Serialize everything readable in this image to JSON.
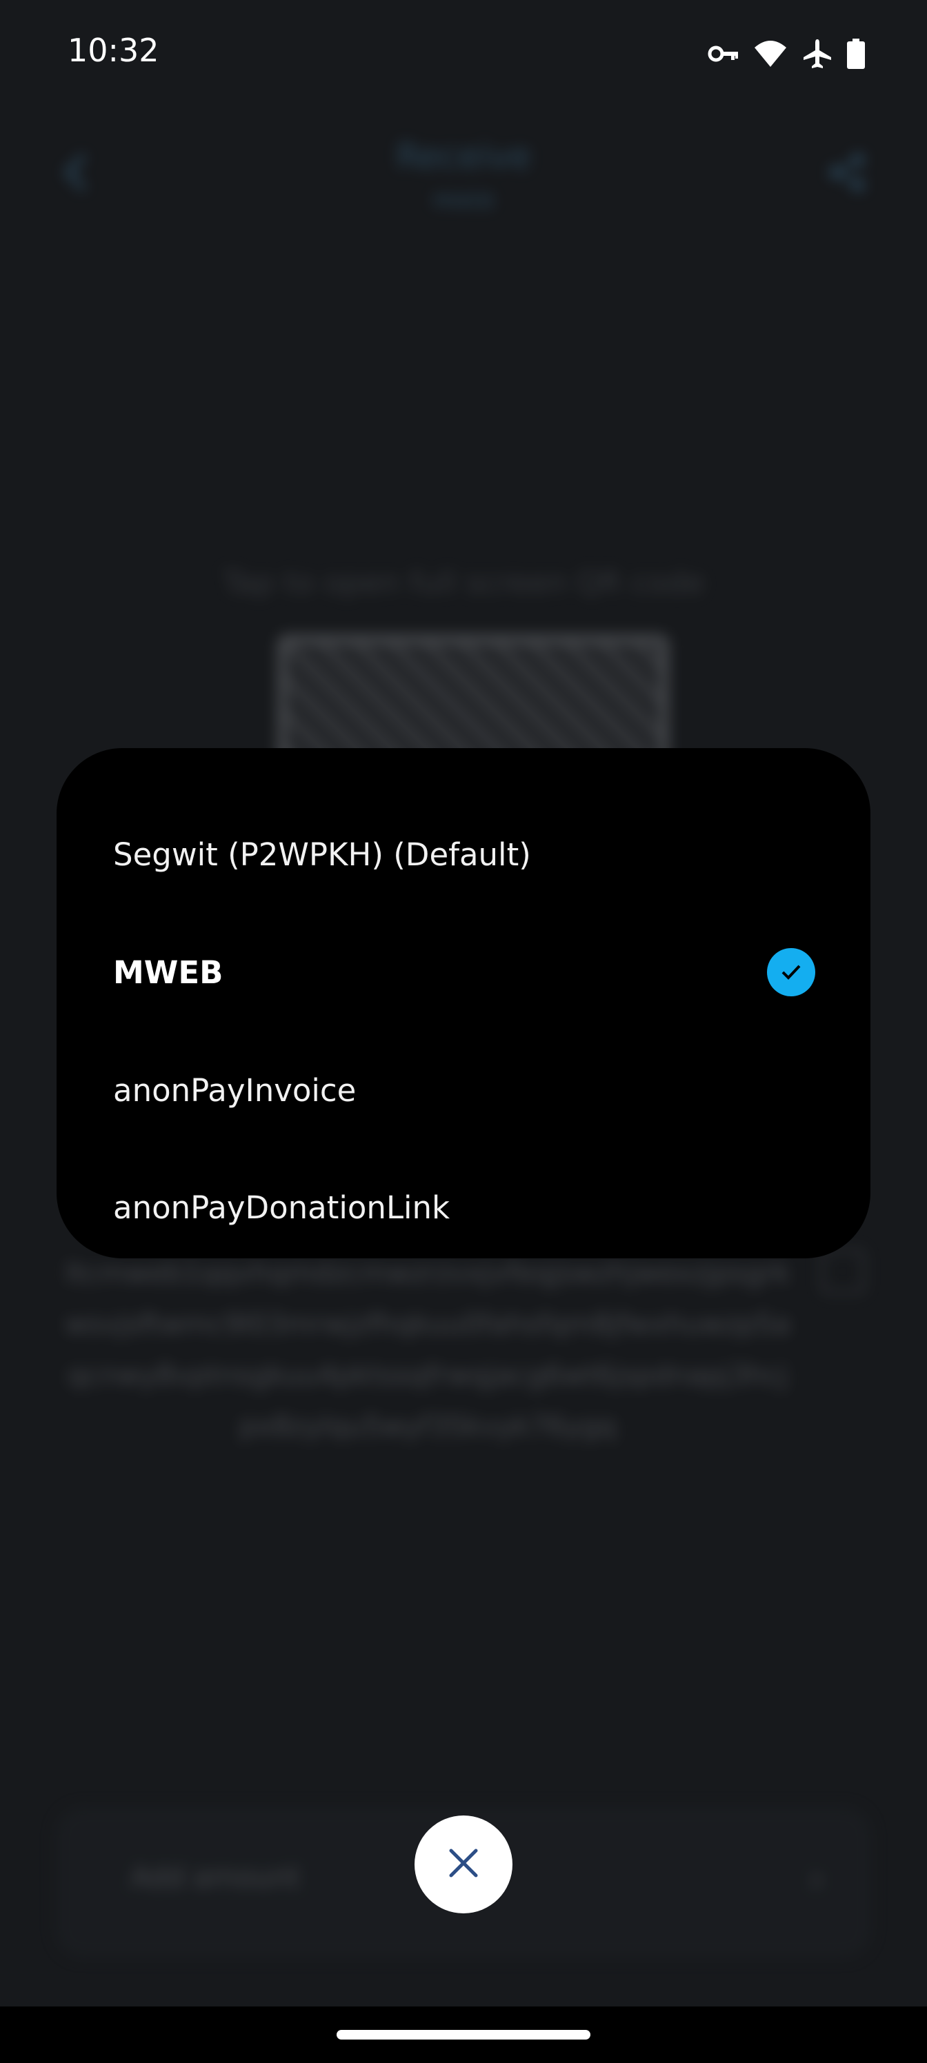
{
  "status_bar": {
    "time": "10:32",
    "icons": [
      "vpn-key-icon",
      "wifi-icon",
      "airplane-mode-icon",
      "battery-icon"
    ]
  },
  "background": {
    "title": "Receive",
    "subtitle": "MWEB",
    "hint": "Tap to open full screen QR code",
    "address": "ltcmweb1qqvhqmdzcmwzrzvxjvfeqjswzhjwexzjpsgrkwsvjsftwmc9l03mrwjzfhqkuu0fahsfqm8jfwxhuwzp5aqcnwy8vptnsgkuu4pktssqfrwqjacg6wt6jspdnapj3hcjpx8zylqu5wyf35kvyk76ygq",
    "amount_label": "Add amount",
    "amount_arrow": "›"
  },
  "popup": {
    "options": [
      {
        "label": "Segwit (P2WPKH) (Default)",
        "selected": false
      },
      {
        "label": "MWEB",
        "selected": true
      },
      {
        "label": "anonPayInvoice",
        "selected": false
      },
      {
        "label": "anonPayDonationLink",
        "selected": false
      }
    ]
  },
  "close_button": {
    "icon": "close-icon"
  },
  "colors": {
    "accent": "#14aef0",
    "popup_bg": "#000000",
    "page_bg": "#17191c",
    "close_icon": "#2c4e86"
  }
}
